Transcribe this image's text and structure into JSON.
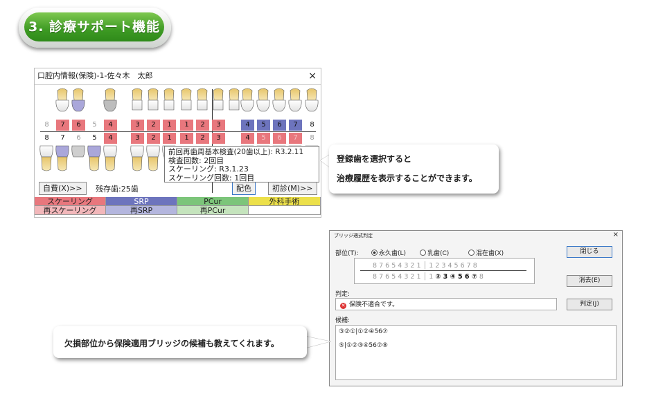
{
  "section": {
    "title": "3. 診療サポート機能"
  },
  "dental_window": {
    "title": "口腔内情報(保険)-1-佐々木　太郎",
    "close": "×",
    "upper_numbers": [
      {
        "n": "8",
        "c": "g"
      },
      {
        "n": "7",
        "c": "r"
      },
      {
        "n": "6",
        "c": "r"
      },
      {
        "n": "5",
        "c": "g"
      },
      {
        "n": "4",
        "c": "r"
      },
      {
        "n": "3",
        "c": "r"
      },
      {
        "n": "2",
        "c": "r"
      },
      {
        "n": "1",
        "c": "r"
      },
      {
        "n": "1",
        "c": "r"
      },
      {
        "n": "2",
        "c": "r"
      },
      {
        "n": "3",
        "c": "r"
      },
      {
        "n": "",
        "c": ""
      },
      {
        "n": "4",
        "c": "b"
      },
      {
        "n": "5",
        "c": "b"
      },
      {
        "n": "6",
        "c": "b"
      },
      {
        "n": "7",
        "c": "b"
      },
      {
        "n": "8",
        "c": ""
      }
    ],
    "lower_numbers": [
      {
        "n": "8",
        "c": ""
      },
      {
        "n": "7",
        "c": ""
      },
      {
        "n": "6",
        "c": "g"
      },
      {
        "n": "5",
        "c": ""
      },
      {
        "n": "4",
        "c": "r"
      },
      {
        "n": "3",
        "c": "r"
      },
      {
        "n": "2",
        "c": "r"
      },
      {
        "n": "1",
        "c": "r"
      },
      {
        "n": "1",
        "c": "r"
      },
      {
        "n": "2",
        "c": "r"
      },
      {
        "n": "3",
        "c": "r"
      },
      {
        "n": "",
        "c": ""
      },
      {
        "n": "4",
        "c": "r"
      },
      {
        "n": "5",
        "c": "lr"
      },
      {
        "n": "6",
        "c": "lr"
      },
      {
        "n": "7",
        "c": "lr"
      },
      {
        "n": "8",
        "c": "g"
      }
    ],
    "self_pay_button": "自費(X)>>",
    "remaining_teeth": "残存歯:25歯",
    "color_button": "配色",
    "first_visit_button": "初診(M)>>",
    "legend_row1": [
      "スケーリング",
      "SRP",
      "PCur",
      "外科手術"
    ],
    "legend_row2": [
      "再スケーリング",
      "再SRP",
      "再PCur",
      ""
    ],
    "colors": {
      "scaling": "#e8777d",
      "srp": "#6d74bd",
      "pcur": "#7cc57a",
      "surgery": "#ece04a",
      "rescaling": "#f2b7ba",
      "resrp": "#b4b6de",
      "repcur": "#c5e4bd"
    }
  },
  "tooltip": {
    "line1": "前回再歯周基本検査(20歯以上): R3.2.11",
    "line2": "検査回数: 2回目",
    "line3": "スケーリング: R3.1.23",
    "line4": "スケーリング回数: 1回目"
  },
  "callout_top": {
    "line1": "登録歯を選択すると",
    "line2": "治療履歴を表示することができます。"
  },
  "callout_bottom": {
    "text": "欠損部位から保険適用ブリッジの候補も教えてくれます。"
  },
  "bridge_dialog": {
    "title": "ブリッジ適式判定",
    "close": "×",
    "part_label": "部位(T):",
    "radio_permanent": "永久歯(L)",
    "radio_primary": "乳歯(C)",
    "radio_mixed": "混在歯(X)",
    "upper_row": "8 7 6 5 4 3 2 1 │ 1 2 3 4 5 6 7 8",
    "lower_row_left": "8 7 6 5 4 3 2 1 │ 1 ",
    "lower_row_bold": "② 3 ④ 5 6 ⑦",
    "lower_row_end": " 8",
    "close_button": "閉じる",
    "clear_button": "消去(E)",
    "judge_label": "判定:",
    "judge_result": "保険不適合です。",
    "judge_button": "判定(J)",
    "candidate_label": "候補:",
    "candidates": [
      "③②①|①②④56⑦",
      "⑤|①②③④56⑦⑧"
    ]
  }
}
